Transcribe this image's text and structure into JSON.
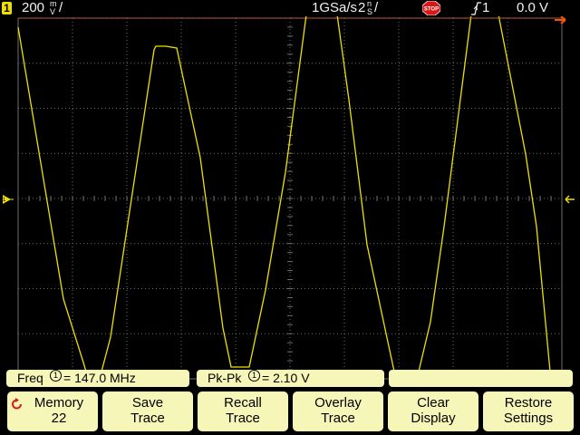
{
  "status": {
    "channel": "1",
    "vertical_scale": "200",
    "vertical_unit_top": "m",
    "vertical_unit_bottom": "V",
    "sample_rate": "1GSa/s",
    "timebase": "2",
    "timebase_unit_top": "n",
    "timebase_unit_bottom": "S",
    "run_state": "STOP",
    "trigger_source": "1",
    "trigger_level": "0.0 V"
  },
  "colors": {
    "trace": "#f0e000",
    "grid": "#6e6e6e",
    "trigger_marker": "#ff5000",
    "softkey_bg": "#f6f6b8",
    "stop_badge": "#d81818"
  },
  "measurements": {
    "freq_label": "Freq",
    "freq_channel": "1",
    "freq_value": "= 147.0 MHz",
    "pkpk_label": "Pk-Pk",
    "pkpk_channel": "1",
    "pkpk_value": "=  2.10  V"
  },
  "softkeys": [
    {
      "line1": "Memory",
      "line2": "22",
      "icon": "rotate-knob-icon"
    },
    {
      "line1": "Save",
      "line2": "Trace"
    },
    {
      "line1": "Recall",
      "line2": "Trace"
    },
    {
      "line1": "Overlay",
      "line2": "Trace"
    },
    {
      "line1": "Clear",
      "line2": "Display"
    },
    {
      "line1": "Restore",
      "line2": "Settings"
    }
  ]
}
